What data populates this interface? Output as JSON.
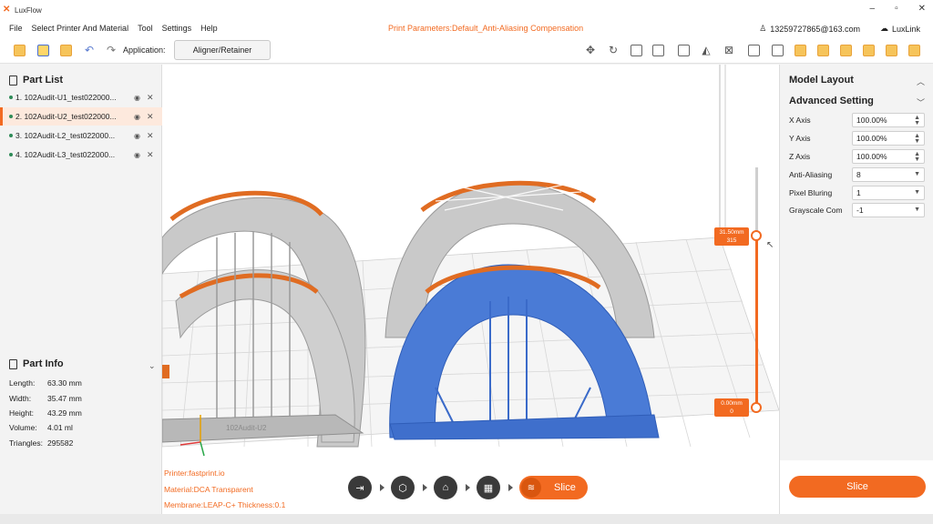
{
  "window": {
    "app_name": "LuxFlow",
    "logo_glyph": "✕",
    "controls": [
      "–",
      "▫",
      "✕"
    ]
  },
  "menu": {
    "items": [
      "File",
      "Select Printer And Material",
      "Tool",
      "Settings",
      "Help"
    ]
  },
  "header": {
    "print_params": "Print Parameters:Default_Anti-Aliasing Compensation",
    "account": "13259727865@163.com",
    "luxlink": "LuxLink"
  },
  "toolbar": {
    "application_label": "Application:",
    "application_value": "Aligner/Retainer",
    "icons": [
      "import-icon",
      "add-file-icon",
      "save-icon",
      "undo-icon",
      "redo-icon",
      "move-icon",
      "rotate-icon",
      "scale-icon",
      "mirror-icon",
      "hollow-icon",
      "support-icon",
      "auto-support-icon",
      "layout-icon",
      "front-view-icon",
      "back-view-icon",
      "left-view-icon",
      "right-view-icon",
      "top-view-icon",
      "bottom-view-icon"
    ]
  },
  "part_list": {
    "title": "Part List",
    "items": [
      {
        "label": "1. 102Audit-U1_test022000..."
      },
      {
        "label": "2. 102Audit-U2_test022000..."
      },
      {
        "label": "3. 102Audit-L2_test022000..."
      },
      {
        "label": "4. 102Audit-L3_test022000..."
      }
    ],
    "selected_index": 1
  },
  "part_info": {
    "title": "Part Info",
    "rows": [
      {
        "k": "Length:",
        "v": "63.30 mm"
      },
      {
        "k": "Width:",
        "v": "35.47 mm"
      },
      {
        "k": "Height:",
        "v": "43.29 mm"
      },
      {
        "k": "Volume:",
        "v": "4.01 ml"
      },
      {
        "k": "Triangles:",
        "v": "295582"
      }
    ]
  },
  "viewport": {
    "printer": "Printer:fastprint.io",
    "material": "Material:DCA Transparent",
    "membrane": "Membrane:LEAP-C+ Thickness:0.1",
    "model_label": "102Audit-U2",
    "slider_top_mm": "31.50mm",
    "slider_top_layer": "315",
    "slider_bottom_mm": "0.00mm",
    "slider_bottom_layer": "0"
  },
  "workflow": {
    "slice_label": "Slice"
  },
  "right_panel": {
    "model_layout": "Model Layout",
    "advanced_setting": "Advanced Setting",
    "rows": [
      {
        "k": "X Axis",
        "v": "100.00%"
      },
      {
        "k": "Y Axis",
        "v": "100.00%"
      },
      {
        "k": "Z Axis",
        "v": "100.00%"
      },
      {
        "k": "Anti-Aliasing",
        "v": "8"
      },
      {
        "k": "Pixel Bluring",
        "v": "1"
      },
      {
        "k": "Grayscale Com",
        "v": "-1"
      }
    ],
    "slice_button": "Slice"
  },
  "colors": {
    "accent": "#f26a21",
    "model_gray": "#c7c7c7",
    "model_blue": "#4a7bd6"
  }
}
